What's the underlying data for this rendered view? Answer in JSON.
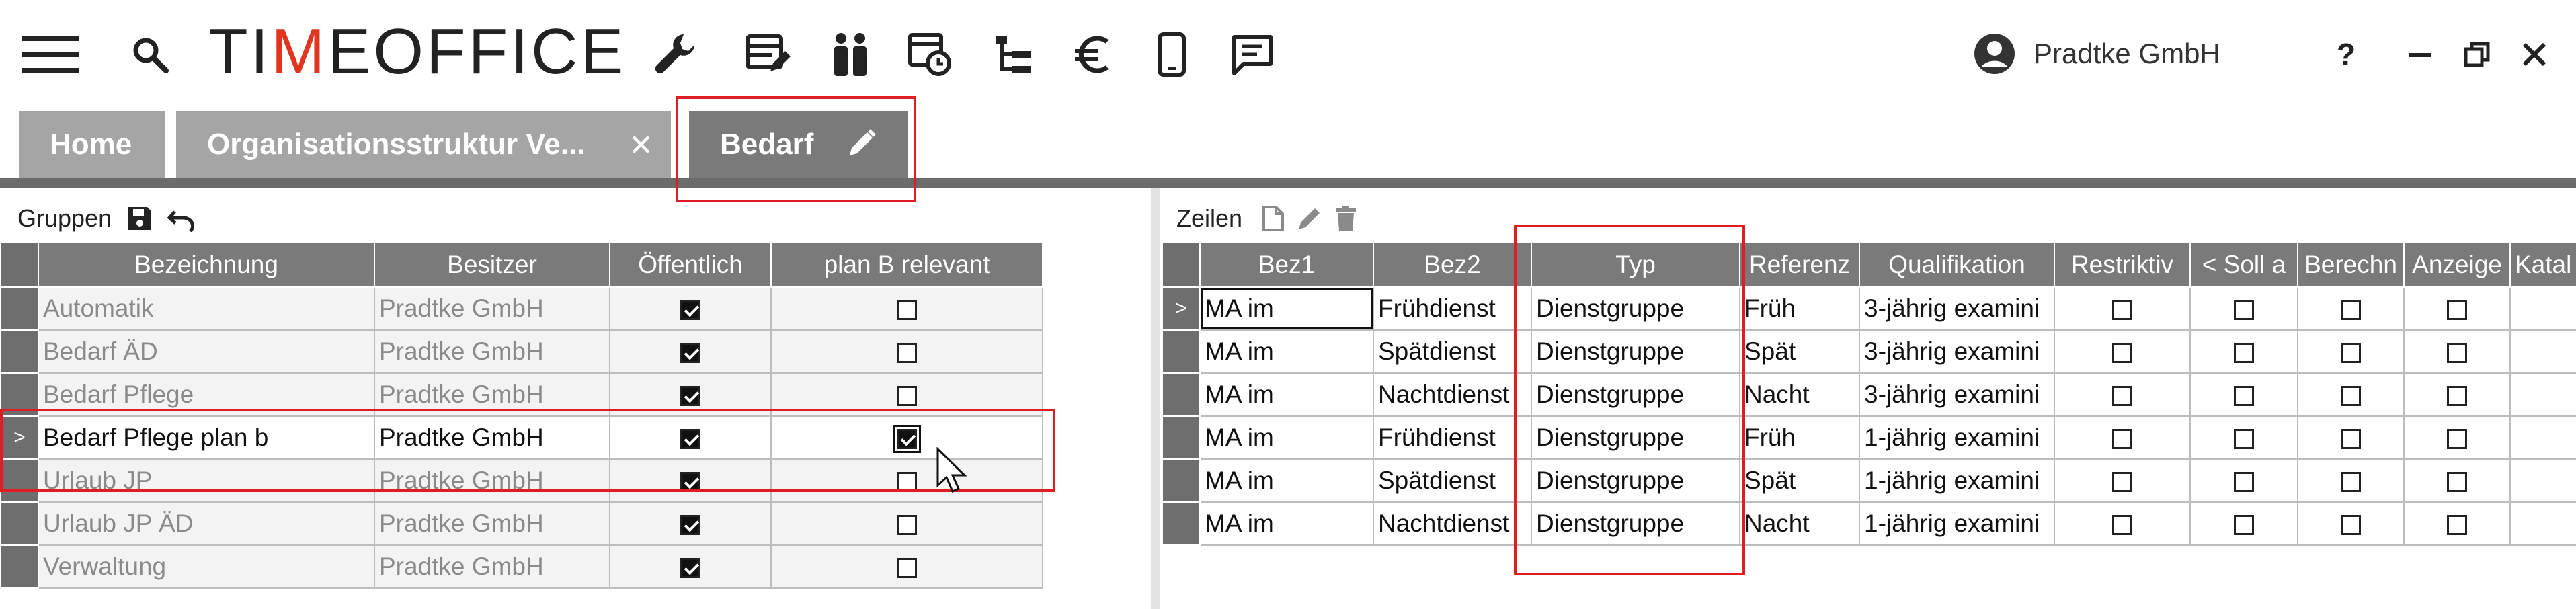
{
  "app": {
    "logo_main": "TI",
    "logo_accent": "M",
    "logo_rest": "EOFFICE",
    "accent_color": "#e0361f",
    "user_name": "Pradtke GmbH",
    "help_label": "?"
  },
  "tabs": [
    {
      "label": "Home"
    },
    {
      "label": "Organisationsstruktur Ve..."
    },
    {
      "label": "Bedarf"
    }
  ],
  "left": {
    "title": "Gruppen",
    "columns": [
      "Bezeichnung",
      "Besitzer",
      "Öffentlich",
      "plan B relevant"
    ],
    "rows": [
      {
        "ind": "",
        "name": "Automatik",
        "owner": "Pradtke GmbH",
        "public": true,
        "planb": false
      },
      {
        "ind": "",
        "name": "Bedarf ÄD",
        "owner": "Pradtke GmbH",
        "public": true,
        "planb": false
      },
      {
        "ind": "",
        "name": "Bedarf Pflege",
        "owner": "Pradtke GmbH",
        "public": true,
        "planb": false
      },
      {
        "ind": ">",
        "name": "Bedarf Pflege plan b",
        "owner": "Pradtke GmbH",
        "public": true,
        "planb": true
      },
      {
        "ind": "",
        "name": "Urlaub JP",
        "owner": "Pradtke GmbH",
        "public": true,
        "planb": false
      },
      {
        "ind": "",
        "name": "Urlaub JP ÄD",
        "owner": "Pradtke GmbH",
        "public": true,
        "planb": false
      },
      {
        "ind": "",
        "name": "Verwaltung",
        "owner": "Pradtke GmbH",
        "public": true,
        "planb": false
      }
    ]
  },
  "right": {
    "title": "Zeilen",
    "columns": [
      "Bez1",
      "Bez2",
      "Typ",
      "Referenz",
      "Qualifikation",
      "Restriktiv",
      "< Soll a",
      "Berechn",
      "Anzeige",
      "Katal"
    ],
    "rows": [
      {
        "ind": ">",
        "bez1": "MA im",
        "bez2": "Frühdienst",
        "typ": "Dienstgruppe",
        "ref": "Früh",
        "qual": "3-jährig examini"
      },
      {
        "ind": "",
        "bez1": "MA im",
        "bez2": "Spätdienst",
        "typ": "Dienstgruppe",
        "ref": "Spät",
        "qual": "3-jährig examini"
      },
      {
        "ind": "",
        "bez1": "MA im",
        "bez2": "Nachtdienst",
        "typ": "Dienstgruppe",
        "ref": "Nacht",
        "qual": "3-jährig examini"
      },
      {
        "ind": "",
        "bez1": "MA im",
        "bez2": "Frühdienst",
        "typ": "Dienstgruppe",
        "ref": "Früh",
        "qual": "1-jährig examini"
      },
      {
        "ind": "",
        "bez1": "MA im",
        "bez2": "Spätdienst",
        "typ": "Dienstgruppe",
        "ref": "Spät",
        "qual": "1-jährig examini"
      },
      {
        "ind": "",
        "bez1": "MA im",
        "bez2": "Nachtdienst",
        "typ": "Dienstgruppe",
        "ref": "Nacht",
        "qual": "1-jährig examini"
      }
    ]
  },
  "colors": {
    "tab": "#a5a5a5",
    "tab_active": "#7a7a7a",
    "header_cell": "#7a7a7a",
    "highlight": "#e11d24"
  }
}
